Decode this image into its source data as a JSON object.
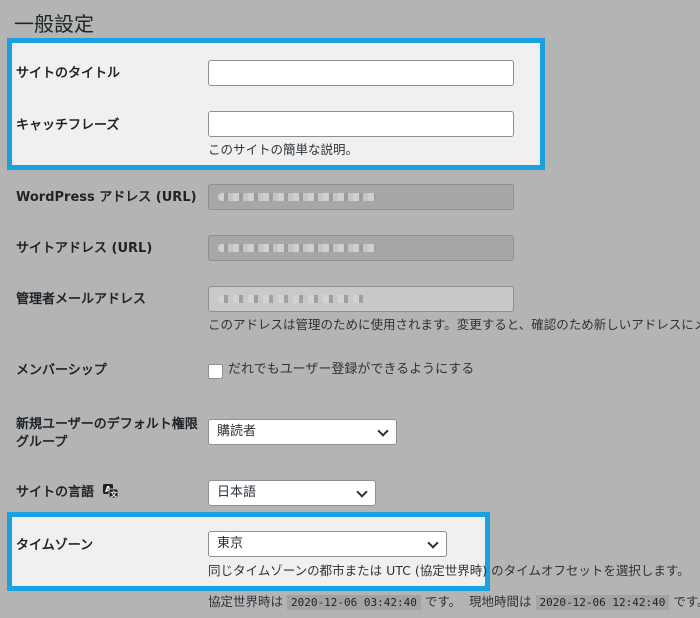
{
  "page": {
    "title": "一般設定"
  },
  "fields": {
    "site_title": {
      "label": "サイトのタイトル",
      "value": ""
    },
    "tagline": {
      "label": "キャッチフレーズ",
      "value": "",
      "description": "このサイトの簡単な説明。"
    },
    "wp_address": {
      "label": "WordPress アドレス (URL)"
    },
    "site_address": {
      "label": "サイトアドレス (URL)"
    },
    "admin_email": {
      "label": "管理者メールアドレス",
      "description": "このアドレスは管理のために使用されます。変更すると、確認のため新しいアドレスにメ"
    },
    "membership": {
      "label": "メンバーシップ",
      "checkbox_label": "だれでもユーザー登録ができるようにする"
    },
    "default_role": {
      "label_line1": "新規ユーザーのデフォルト権限",
      "label_line2": "グループ",
      "value": "購読者"
    },
    "site_language": {
      "label": "サイトの言語",
      "value": "日本語",
      "icon": "translate-icon"
    },
    "timezone": {
      "label": "タイムゾーン",
      "value": "東京",
      "description": "同じタイムゾーンの都市または UTC (協定世界時) のタイムオフセットを選択します。",
      "utc_label": "協定世界時は",
      "utc_time": "2020-12-06 03:42:40",
      "utc_suffix": "です。",
      "local_label": "現地時間は",
      "local_time": "2020-12-06 12:42:40",
      "local_suffix": "です。"
    }
  },
  "colors": {
    "highlight": "#1aa1df",
    "page_bg": "#b4b4b4"
  }
}
